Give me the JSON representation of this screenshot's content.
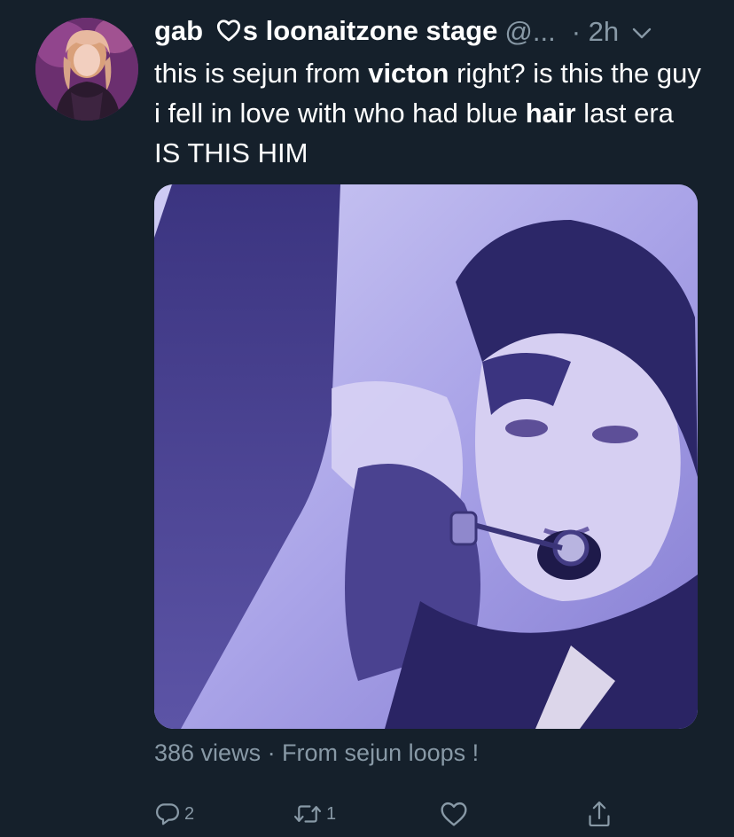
{
  "author": {
    "display_name_pre": "gab",
    "display_name_post": "s loonaitzone stage",
    "handle": "@...",
    "time": "· 2h"
  },
  "tweet": {
    "segments": [
      {
        "text": "this is sejun from ",
        "bold": false
      },
      {
        "text": "victon",
        "bold": true
      },
      {
        "text": " right? is this the guy i fell in love with who had blue ",
        "bold": false
      },
      {
        "text": "hair",
        "bold": true
      },
      {
        "text": " last era IS THIS HIM",
        "bold": false
      }
    ]
  },
  "media": {
    "views_line": "386 views · From sejun loops !"
  },
  "actions": {
    "reply_count": "2",
    "retweet_count": "1",
    "like_count": "",
    "share_count": ""
  },
  "icons": {
    "reply": "reply-icon",
    "retweet": "retweet-icon",
    "like": "like-icon",
    "share": "share-icon",
    "menu": "chevron-down-icon",
    "heart": "heart-outline-icon"
  },
  "colors": {
    "background": "#15202b",
    "secondary_text": "#8899a6",
    "primary_text": "#ffffff"
  }
}
